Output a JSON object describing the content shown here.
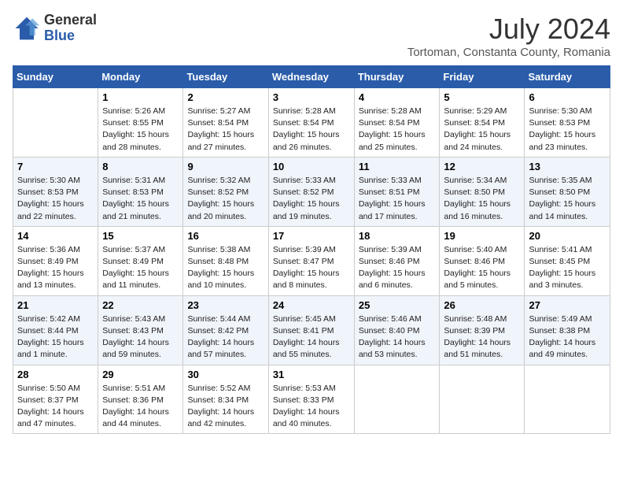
{
  "header": {
    "logo_general": "General",
    "logo_blue": "Blue",
    "month_year": "July 2024",
    "location": "Tortoman, Constanta County, Romania"
  },
  "days_of_week": [
    "Sunday",
    "Monday",
    "Tuesday",
    "Wednesday",
    "Thursday",
    "Friday",
    "Saturday"
  ],
  "weeks": [
    [
      {
        "num": "",
        "info": ""
      },
      {
        "num": "1",
        "info": "Sunrise: 5:26 AM\nSunset: 8:55 PM\nDaylight: 15 hours\nand 28 minutes."
      },
      {
        "num": "2",
        "info": "Sunrise: 5:27 AM\nSunset: 8:54 PM\nDaylight: 15 hours\nand 27 minutes."
      },
      {
        "num": "3",
        "info": "Sunrise: 5:28 AM\nSunset: 8:54 PM\nDaylight: 15 hours\nand 26 minutes."
      },
      {
        "num": "4",
        "info": "Sunrise: 5:28 AM\nSunset: 8:54 PM\nDaylight: 15 hours\nand 25 minutes."
      },
      {
        "num": "5",
        "info": "Sunrise: 5:29 AM\nSunset: 8:54 PM\nDaylight: 15 hours\nand 24 minutes."
      },
      {
        "num": "6",
        "info": "Sunrise: 5:30 AM\nSunset: 8:53 PM\nDaylight: 15 hours\nand 23 minutes."
      }
    ],
    [
      {
        "num": "7",
        "info": "Sunrise: 5:30 AM\nSunset: 8:53 PM\nDaylight: 15 hours\nand 22 minutes."
      },
      {
        "num": "8",
        "info": "Sunrise: 5:31 AM\nSunset: 8:53 PM\nDaylight: 15 hours\nand 21 minutes."
      },
      {
        "num": "9",
        "info": "Sunrise: 5:32 AM\nSunset: 8:52 PM\nDaylight: 15 hours\nand 20 minutes."
      },
      {
        "num": "10",
        "info": "Sunrise: 5:33 AM\nSunset: 8:52 PM\nDaylight: 15 hours\nand 19 minutes."
      },
      {
        "num": "11",
        "info": "Sunrise: 5:33 AM\nSunset: 8:51 PM\nDaylight: 15 hours\nand 17 minutes."
      },
      {
        "num": "12",
        "info": "Sunrise: 5:34 AM\nSunset: 8:50 PM\nDaylight: 15 hours\nand 16 minutes."
      },
      {
        "num": "13",
        "info": "Sunrise: 5:35 AM\nSunset: 8:50 PM\nDaylight: 15 hours\nand 14 minutes."
      }
    ],
    [
      {
        "num": "14",
        "info": "Sunrise: 5:36 AM\nSunset: 8:49 PM\nDaylight: 15 hours\nand 13 minutes."
      },
      {
        "num": "15",
        "info": "Sunrise: 5:37 AM\nSunset: 8:49 PM\nDaylight: 15 hours\nand 11 minutes."
      },
      {
        "num": "16",
        "info": "Sunrise: 5:38 AM\nSunset: 8:48 PM\nDaylight: 15 hours\nand 10 minutes."
      },
      {
        "num": "17",
        "info": "Sunrise: 5:39 AM\nSunset: 8:47 PM\nDaylight: 15 hours\nand 8 minutes."
      },
      {
        "num": "18",
        "info": "Sunrise: 5:39 AM\nSunset: 8:46 PM\nDaylight: 15 hours\nand 6 minutes."
      },
      {
        "num": "19",
        "info": "Sunrise: 5:40 AM\nSunset: 8:46 PM\nDaylight: 15 hours\nand 5 minutes."
      },
      {
        "num": "20",
        "info": "Sunrise: 5:41 AM\nSunset: 8:45 PM\nDaylight: 15 hours\nand 3 minutes."
      }
    ],
    [
      {
        "num": "21",
        "info": "Sunrise: 5:42 AM\nSunset: 8:44 PM\nDaylight: 15 hours\nand 1 minute."
      },
      {
        "num": "22",
        "info": "Sunrise: 5:43 AM\nSunset: 8:43 PM\nDaylight: 14 hours\nand 59 minutes."
      },
      {
        "num": "23",
        "info": "Sunrise: 5:44 AM\nSunset: 8:42 PM\nDaylight: 14 hours\nand 57 minutes."
      },
      {
        "num": "24",
        "info": "Sunrise: 5:45 AM\nSunset: 8:41 PM\nDaylight: 14 hours\nand 55 minutes."
      },
      {
        "num": "25",
        "info": "Sunrise: 5:46 AM\nSunset: 8:40 PM\nDaylight: 14 hours\nand 53 minutes."
      },
      {
        "num": "26",
        "info": "Sunrise: 5:48 AM\nSunset: 8:39 PM\nDaylight: 14 hours\nand 51 minutes."
      },
      {
        "num": "27",
        "info": "Sunrise: 5:49 AM\nSunset: 8:38 PM\nDaylight: 14 hours\nand 49 minutes."
      }
    ],
    [
      {
        "num": "28",
        "info": "Sunrise: 5:50 AM\nSunset: 8:37 PM\nDaylight: 14 hours\nand 47 minutes."
      },
      {
        "num": "29",
        "info": "Sunrise: 5:51 AM\nSunset: 8:36 PM\nDaylight: 14 hours\nand 44 minutes."
      },
      {
        "num": "30",
        "info": "Sunrise: 5:52 AM\nSunset: 8:34 PM\nDaylight: 14 hours\nand 42 minutes."
      },
      {
        "num": "31",
        "info": "Sunrise: 5:53 AM\nSunset: 8:33 PM\nDaylight: 14 hours\nand 40 minutes."
      },
      {
        "num": "",
        "info": ""
      },
      {
        "num": "",
        "info": ""
      },
      {
        "num": "",
        "info": ""
      }
    ]
  ]
}
